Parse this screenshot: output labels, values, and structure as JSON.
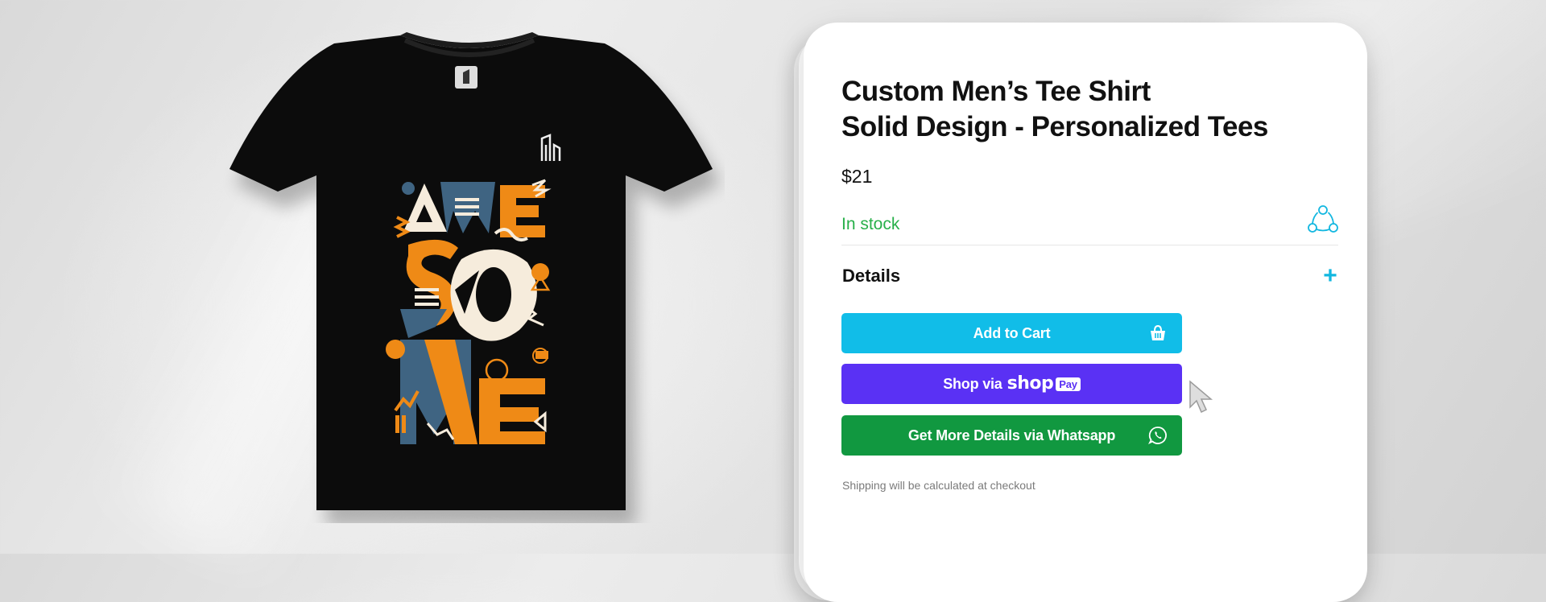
{
  "product": {
    "title_line1": "Custom Men’s Tee Shirt",
    "title_line2": "Solid Design - Personalized Tees",
    "price": "$21",
    "stock_status": "In stock",
    "details_label": "Details"
  },
  "buttons": {
    "add_to_cart": "Add to Cart",
    "shop_via_prefix": "Shop via",
    "shop_brand": "shop",
    "shop_pay_badge": "Pay",
    "whatsapp": "Get More Details via Whatsapp"
  },
  "shipping_note": "Shipping will be calculated at checkout",
  "icons": {
    "share": "share-icon",
    "expand": "plus-icon",
    "cart": "basket-icon",
    "whatsapp": "whatsapp-icon",
    "pointer": "mouse-cursor-icon"
  },
  "colors": {
    "stock_green": "#28b04a",
    "accent_cyan": "#11bde8",
    "shop_purple": "#5a31f4",
    "whatsapp_green": "#119840",
    "shirt_black": "#0c0c0c",
    "print_orange": "#ef8a16",
    "print_slate": "#3f6482",
    "print_cream": "#f6ecdc"
  }
}
